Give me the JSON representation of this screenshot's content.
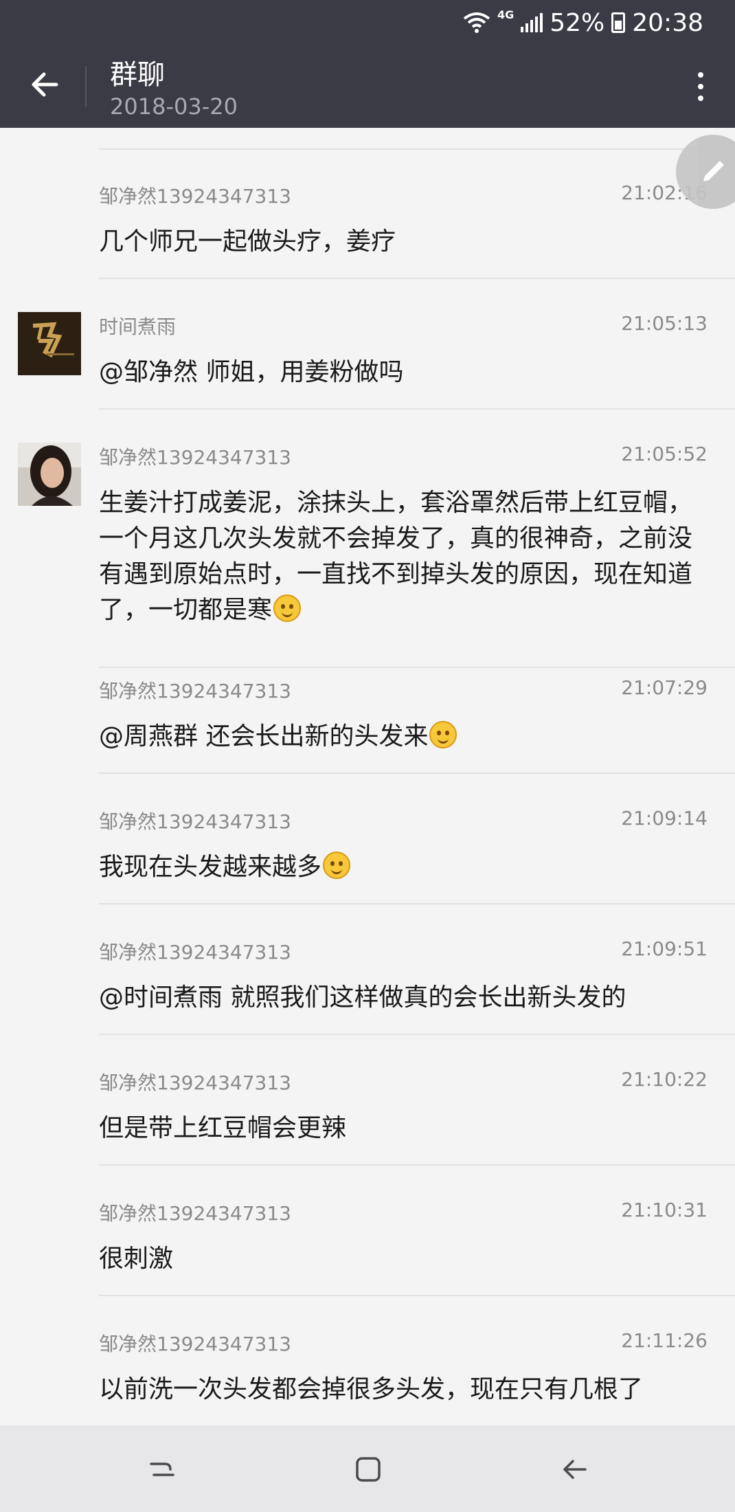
{
  "status": {
    "network": "4G",
    "battery": "52%",
    "time": "20:38"
  },
  "header": {
    "title": "群聊",
    "date": "2018-03-20"
  },
  "messages": [
    {
      "name": "邹净然13924347313",
      "time": "21:02:16",
      "text": "几个师兄一起做头疗，姜疗",
      "avatar": null
    },
    {
      "name": "时间煮雨",
      "time": "21:05:13",
      "text": "@邹净然 师姐，用姜粉做吗",
      "avatar": "dark-calligraphy"
    },
    {
      "name": "邹净然13924347313",
      "time": "21:05:52",
      "text": "生姜汁打成姜泥，涂抹头上，套浴罩然后带上红豆帽，一个月这几次头发就不会掉发了，真的很神奇，之前没有遇到原始点时，一直找不到掉头发的原因，现在知道了，一切都是寒",
      "emoji": "smile",
      "avatar": "woman-photo"
    },
    {
      "name": "邹净然13924347313",
      "time": "21:07:29",
      "text": "@周燕群 还会长出新的头发来",
      "emoji": "smile"
    },
    {
      "name": "邹净然13924347313",
      "time": "21:09:14",
      "text": "我现在头发越来越多",
      "emoji": "smile"
    },
    {
      "name": "邹净然13924347313",
      "time": "21:09:51",
      "text": "@时间煮雨 就照我们这样做真的会长出新头发的"
    },
    {
      "name": "邹净然13924347313",
      "time": "21:10:22",
      "text": "但是带上红豆帽会更辣"
    },
    {
      "name": "邹净然13924347313",
      "time": "21:10:31",
      "text": "很刺激"
    },
    {
      "name": "邹净然13924347313",
      "time": "21:11:26",
      "text": "以前洗一次头发都会掉很多头发，现在只有几根了"
    }
  ],
  "icons": {
    "back": "arrow-left-icon",
    "more": "more-vertical-icon",
    "edit": "pencil-icon",
    "nav": [
      "recent-apps-icon",
      "home-icon",
      "back-icon"
    ]
  },
  "colors": {
    "header_bg": "#3a3b45",
    "list_bg": "#f4f4f4",
    "nav_bg": "#e7e7e9"
  }
}
